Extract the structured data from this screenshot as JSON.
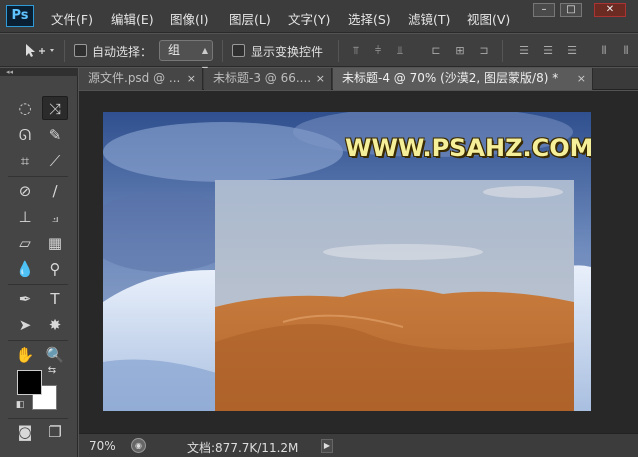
{
  "app": {
    "logo": "Ps"
  },
  "menu": [
    "文件(F)",
    "编辑(E)",
    "图像(I)",
    "图层(L)",
    "文字(Y)",
    "选择(S)",
    "滤镜(T)",
    "视图(V)"
  ],
  "window_controls": {
    "minimize": "–",
    "maximize": "□",
    "close": "✕"
  },
  "options": {
    "auto_select_label": "自动选择：",
    "auto_select_value": "组",
    "show_transform_label": "显示变换控件"
  },
  "tabs": [
    {
      "label": "源文件.psd @ ...",
      "active": false
    },
    {
      "label": "未标题-3 @ 66....",
      "active": false
    },
    {
      "label": "未标题-4 @ 70% (沙漠2, 图层蒙版/8) *",
      "active": true
    }
  ],
  "tab_close": "×",
  "canvas": {
    "watermark": "WWW.PSAHZ.COM"
  },
  "status": {
    "zoom": "70%",
    "doc_info": "文档:877.7K/11.2M"
  },
  "colors": {
    "foreground": "#000000",
    "background": "#ffffff",
    "accent": "#2e9bd6"
  },
  "tools": [
    "move-tool",
    "marquee-tool",
    "lasso-tool",
    "quick-select-tool",
    "crop-tool",
    "eyedropper-tool",
    "healing-tool",
    "brush-tool",
    "stamp-tool",
    "history-brush-tool",
    "eraser-tool",
    "gradient-tool",
    "blur-tool",
    "dodge-tool",
    "pen-tool",
    "type-tool",
    "path-select-tool",
    "shape-tool",
    "hand-tool",
    "zoom-tool",
    "quick-mask-tool",
    "screen-mode-tool"
  ]
}
